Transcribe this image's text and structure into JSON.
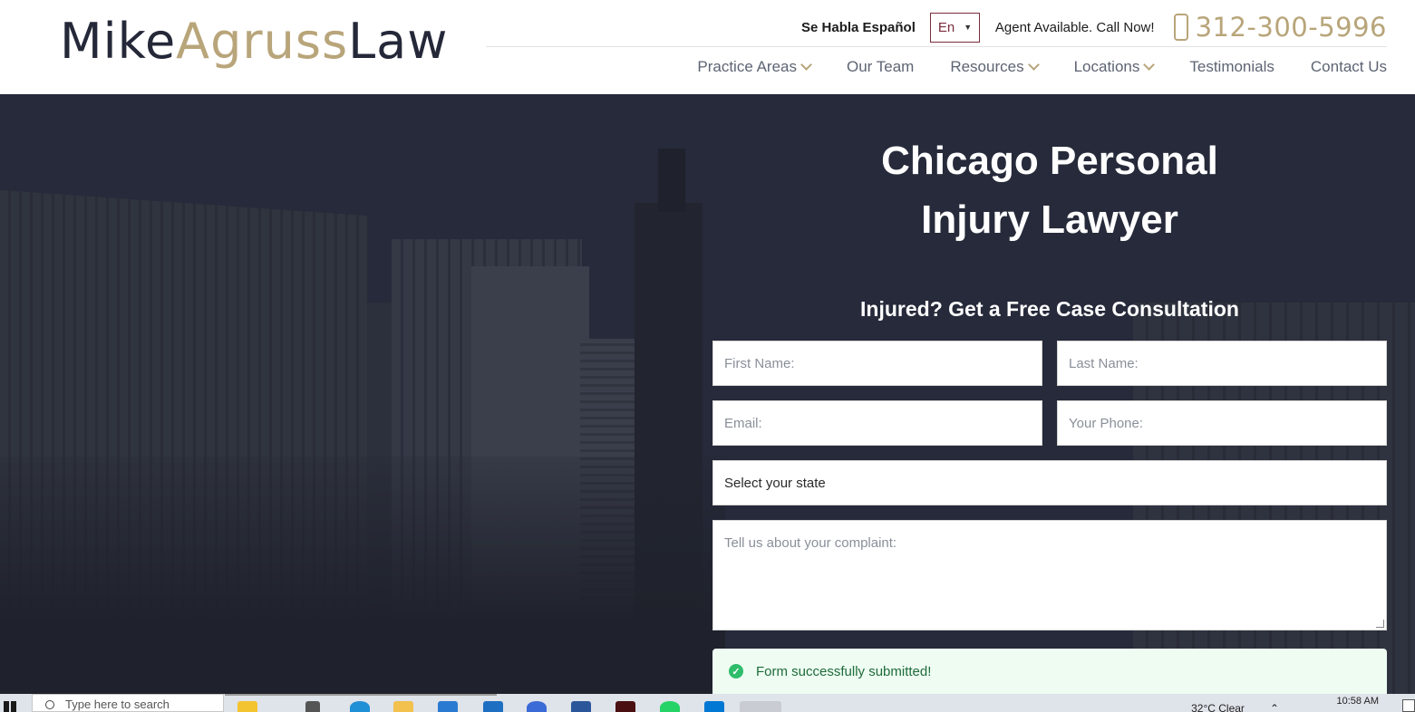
{
  "header": {
    "logo": {
      "part1": "Mike",
      "part2": "Agruss",
      "part3": "Law"
    },
    "habla": "Se Habla Español",
    "language": "En",
    "agent_text": "Agent Available. Call Now!",
    "phone": "312-300-5996",
    "nav": [
      {
        "label": "Practice Areas",
        "dropdown": true
      },
      {
        "label": "Our Team",
        "dropdown": false
      },
      {
        "label": "Resources",
        "dropdown": true
      },
      {
        "label": "Locations",
        "dropdown": true
      },
      {
        "label": "Testimonials",
        "dropdown": false
      },
      {
        "label": "Contact Us",
        "dropdown": false
      }
    ]
  },
  "hero": {
    "title_line1": "Chicago Personal",
    "title_line2": "Injury Lawyer",
    "form_title": "Injured? Get a Free Case Consultation",
    "fields": {
      "first_name": "First Name:",
      "last_name": "Last Name:",
      "email": "Email:",
      "phone": "Your Phone:",
      "state": "Select your state",
      "message": "Tell us about your complaint:"
    },
    "success_message": "Form successfully submitted!"
  },
  "taskbar": {
    "search_placeholder": "Type here to search",
    "weather": "32°C  Clear",
    "time": "10:58 AM"
  },
  "colors": {
    "gold": "#b8a57a",
    "navy": "#262a3a",
    "success_bg": "#eefcf2",
    "success_check": "#2ebd6b"
  }
}
